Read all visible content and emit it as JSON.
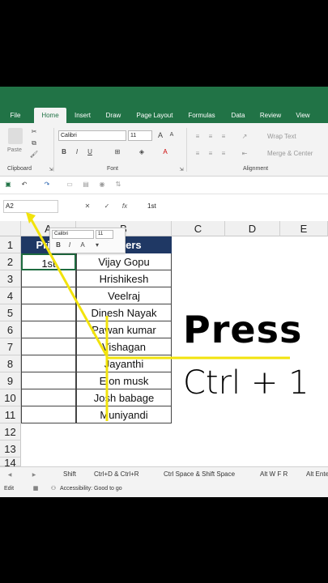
{
  "ribbon": {
    "tabs": [
      "File",
      "Home",
      "Insert",
      "Draw",
      "Page Layout",
      "Formulas",
      "Data",
      "Review",
      "View"
    ],
    "active_tab": "Home",
    "font_name": "Calibri",
    "font_size": "11",
    "paste_label": "Paste",
    "wrap_text_label": "Wrap Text",
    "merge_center_label": "Merge & Center",
    "groups": {
      "clipboard": "Clipboard",
      "font": "Font",
      "alignment": "Alignment"
    },
    "bold": "B",
    "italic": "I",
    "underline": "U"
  },
  "formula_bar": {
    "name_box": "A2",
    "content": "1st",
    "fx": "fx"
  },
  "columns": [
    "A",
    "B",
    "C",
    "D",
    "E"
  ],
  "rows": [
    "1",
    "2",
    "3",
    "4",
    "5",
    "6",
    "7",
    "8",
    "9",
    "10",
    "11",
    "12",
    "13",
    "14"
  ],
  "table": {
    "header_a": "Prize",
    "header_b": "Winers",
    "a2": "1st",
    "winners": [
      "Vijay Gopu",
      "Hrishikesh",
      "Veelraj",
      "Dinesh Nayak",
      "Pawan kumar",
      "Vishagan",
      "Jayanthi",
      "Elon musk",
      "Josh babage",
      "Muniyandi"
    ]
  },
  "mini_toolbar": {
    "font": "Calibri",
    "size": "11",
    "b": "B",
    "i": "I",
    "a": "A"
  },
  "sheet_tabs": [
    "Shift",
    "Ctrl+D & Ctrl+R",
    "Ctrl Space & Shift Space",
    "Alt W F R",
    "Alt Ente"
  ],
  "status": {
    "mode": "Edit",
    "accessibility": "Accessibility: Good to go"
  },
  "overlay": {
    "press": "Press",
    "shortcut": "Ctrl + 1"
  },
  "colors": {
    "excel_green": "#217346",
    "header_fill": "#1f3864",
    "arrow": "#f2e30c"
  }
}
